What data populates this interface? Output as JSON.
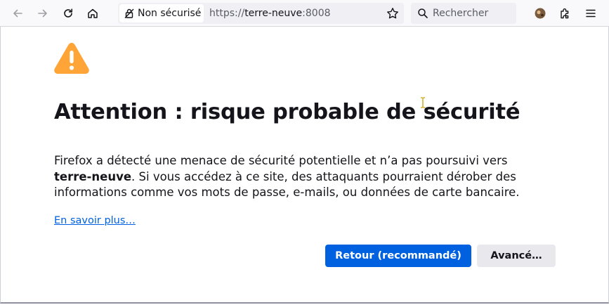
{
  "toolbar": {
    "site_security_label": "Non sécurisé",
    "url_scheme": "https://",
    "url_host": "terre-neuve",
    "url_port": ":8008",
    "search_placeholder": "Rechercher"
  },
  "page": {
    "title": "Attention : risque probable de sécurité",
    "description_before": "Firefox a détecté une menace de sécurité potentielle et n’a pas poursuivi vers ",
    "description_host": "terre-neuve",
    "description_after": ". Si vous accédez à ce site, des attaquants pourraient dérober des informations comme vos mots de passe, e-mails, ou données de carte bancaire.",
    "learn_more": "En savoir plus…",
    "back_button": "Retour (recommandé)",
    "advanced_button": "Avancé…"
  },
  "icons": {
    "back": "arrow-left-icon",
    "forward": "arrow-right-icon",
    "reload": "reload-icon",
    "home": "home-icon",
    "security": "lock-slash-icon",
    "bookmark": "star-icon",
    "search": "search-icon",
    "profile": "profile-avatar-icon",
    "extensions": "puzzle-icon",
    "menu": "hamburger-menu-icon",
    "warning": "warning-triangle-icon"
  },
  "colors": {
    "accent": "#0061e0",
    "warning": "#ffa436",
    "text": "#15141a"
  }
}
